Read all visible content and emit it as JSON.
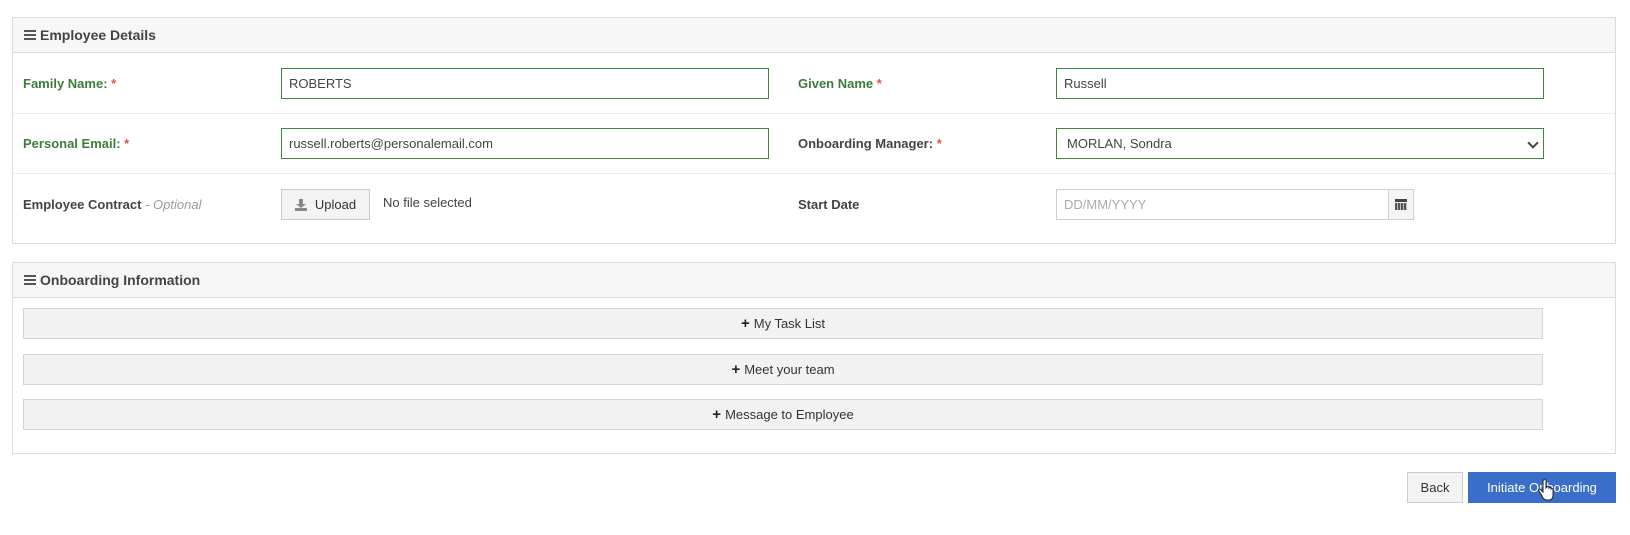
{
  "employee_details": {
    "title": "Employee Details",
    "icon": "hamburger-icon",
    "family_name": {
      "label": "Family Name:",
      "required_marker": "*",
      "value": "ROBERTS"
    },
    "given_name": {
      "label": "Given Name",
      "required_marker": "*",
      "value": "Russell"
    },
    "personal_email": {
      "label": "Personal Email:",
      "required_marker": "*",
      "value": "russell.roberts@personalemail.com"
    },
    "onboarding_manager": {
      "label": "Onboarding Manager:",
      "required_marker": "*",
      "selected": "MORLAN, Sondra"
    },
    "employee_contract": {
      "label": "Employee Contract",
      "optional_label": "- Optional",
      "upload_label": "Upload",
      "file_status": "No file selected"
    },
    "start_date": {
      "label": "Start Date",
      "placeholder": "DD/MM/YYYY",
      "value": ""
    }
  },
  "onboarding_information": {
    "title": "Onboarding Information",
    "icon": "hamburger-icon",
    "sections": [
      {
        "label": "My Task List"
      },
      {
        "label": "Meet your team"
      },
      {
        "label": "Message to Employee"
      }
    ]
  },
  "actions": {
    "back_label": "Back",
    "initiate_label": "Initiate Onboarding"
  },
  "colors": {
    "valid": "#3c7d3c",
    "required": "#e0534a",
    "primary": "#3a6fc9"
  }
}
